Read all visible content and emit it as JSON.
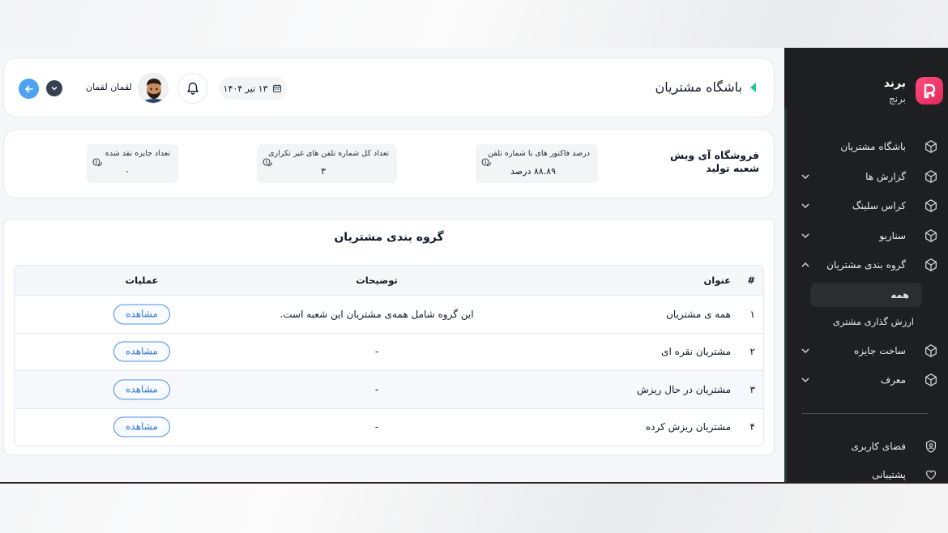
{
  "brand": {
    "name": "برند",
    "subtitle": "برنج",
    "accent": "#e2275a"
  },
  "sidebar": {
    "items": [
      {
        "label": "باشگاه مشتریان",
        "icon": "cube-icon",
        "expandable": false
      },
      {
        "label": "گزارش ها",
        "icon": "cube-icon",
        "expandable": true
      },
      {
        "label": "کراس سلینگ",
        "icon": "cube-icon",
        "expandable": true
      },
      {
        "label": "سناریو",
        "icon": "cube-icon",
        "expandable": true
      },
      {
        "label": "گروه بندی مشتریان",
        "icon": "cube-icon",
        "expandable": true,
        "expanded": true
      },
      {
        "label": "ساخت جایزه",
        "icon": "cube-icon",
        "expandable": true
      },
      {
        "label": "معرف",
        "icon": "cube-icon",
        "expandable": true
      }
    ],
    "subitems": [
      {
        "label": "همه",
        "active": true
      },
      {
        "label": "ارزش گذاری مشتری",
        "active": false
      }
    ],
    "bottom": [
      {
        "label": "فضای کاربری",
        "icon": "user-badge-icon"
      },
      {
        "label": "پشتیبانی",
        "icon": "support-heart-icon"
      }
    ]
  },
  "header": {
    "title": "باشگاه مشتریان",
    "user_name": "لقمان لقمان",
    "date": "۱۳ تیر ۱۴۰۴",
    "title_accent": "#20c997",
    "back_color": "#4da3ef"
  },
  "stats": {
    "store_title": "فروشگاه آی ویش شعبه تولید",
    "items": [
      {
        "label": "درصد فاکتور های با شماره تلفن",
        "value": "۸۸.۸۹ درصد"
      },
      {
        "label": "تعداد کل شماره تلفن های غیر تکراری",
        "value": "۳"
      },
      {
        "label": "تعداد جایزه نقد شده",
        "value": "۰"
      }
    ]
  },
  "groups": {
    "title": "گروه بندی مشتریان",
    "columns": {
      "num": "#",
      "title": "عنوان",
      "desc": "توضیحات",
      "ops": "عملیات"
    },
    "view_label": "مشاهده",
    "rows": [
      {
        "num": "۱",
        "title": "همه ی مشتریان",
        "desc": "این گروه شامل همه‌ی مشتریان این شعبه است."
      },
      {
        "num": "۲",
        "title": "مشتریان نقره ای",
        "desc": "-"
      },
      {
        "num": "۳",
        "title": "مشتریان در حال ریزش",
        "desc": "-"
      },
      {
        "num": "۴",
        "title": "مشتریان ریزش کرده",
        "desc": "-"
      }
    ]
  }
}
